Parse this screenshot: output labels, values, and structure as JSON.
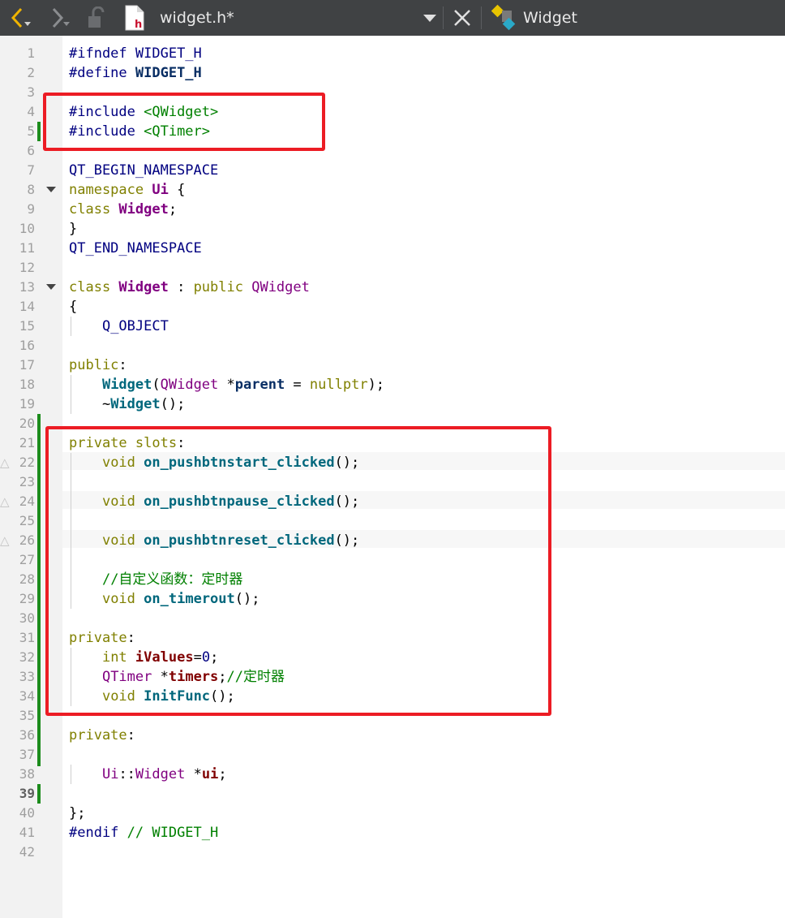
{
  "toolbar": {
    "file_name": "widget.h*",
    "class_name": "Widget",
    "icons": [
      "back-arrow-icon",
      "forward-arrow-icon",
      "lock-icon",
      "header-file-icon",
      "dropdown-arrow-icon",
      "close-icon",
      "class-icon"
    ],
    "colors": {
      "background": "#404244",
      "text": "#e8e8e8",
      "back_arrow": "#f0b400"
    }
  },
  "editor": {
    "line_numbers": [
      "1",
      "2",
      "3",
      "4",
      "5",
      "6",
      "7",
      "8",
      "9",
      "10",
      "11",
      "12",
      "13",
      "14",
      "15",
      "16",
      "17",
      "18",
      "19",
      "20",
      "21",
      "22",
      "23",
      "24",
      "25",
      "26",
      "27",
      "28",
      "29",
      "30",
      "31",
      "32",
      "33",
      "34",
      "35",
      "36",
      "37",
      "38",
      "39",
      "40",
      "41",
      "42"
    ],
    "current_line": "39",
    "folded_lines": [
      "8",
      "13"
    ],
    "warning_lines": [
      "22",
      "24",
      "26"
    ],
    "warning_glyph": "△",
    "lines": {
      "l1a": "#ifndef",
      "l1b": " WIDGET_H",
      "l2a": "#define",
      "l2b": " WIDGET_H",
      "l4a": "#include",
      "l4b": " <QWidget>",
      "l5a": "#include",
      "l5b": " <QTimer>",
      "l7a": "QT_BEGIN_NAMESPACE",
      "l8a": "namespace",
      "l8b": " Ui",
      "l8c": " {",
      "l9a": "class",
      "l9b": " Widget",
      "l9c": ";",
      "l10a": "}",
      "l11a": "QT_END_NAMESPACE",
      "l13a": "class",
      "l13b": " Widget",
      "l13c": " :",
      "l13d": " public",
      "l13e": " QWidget",
      "l14a": "{",
      "l15a": "    ",
      "l15b": "Q_OBJECT",
      "l17a": "public",
      "l17b": ":",
      "l18a": "    ",
      "l18b": "Widget",
      "l18c": "(",
      "l18d": "QWidget",
      "l18e": " *",
      "l18f": "parent",
      "l18g": " = ",
      "l18h": "nullptr",
      "l18i": ");",
      "l19a": "    ~",
      "l19b": "Widget",
      "l19c": "();",
      "l21a": "private",
      "l21b": " slots",
      "l21c": ":",
      "l22a": "    ",
      "l22b": "void",
      "l22c": " ",
      "l22d": "on_pushbtnstart_clicked",
      "l22e": "();",
      "l24a": "    ",
      "l24b": "void",
      "l24c": " ",
      "l24d": "on_pushbtnpause_clicked",
      "l24e": "();",
      "l26a": "    ",
      "l26b": "void",
      "l26c": " ",
      "l26d": "on_pushbtnreset_clicked",
      "l26e": "();",
      "l28a": "    ",
      "l28b": "//自定义函数：定时器",
      "l29a": "    ",
      "l29b": "void",
      "l29c": " ",
      "l29d": "on_timerout",
      "l29e": "();",
      "l31a": "private",
      "l31b": ":",
      "l32a": "    ",
      "l32b": "int",
      "l32c": " ",
      "l32d": "iValues",
      "l32e": "=",
      "l32f": "0",
      "l32g": ";",
      "l33a": "    ",
      "l33b": "QTimer",
      "l33c": " *",
      "l33d": "timers",
      "l33e": ";",
      "l33f": "//定时器",
      "l34a": "    ",
      "l34b": "void",
      "l34c": " ",
      "l34d": "InitFunc",
      "l34e": "();",
      "l36a": "private",
      "l36b": ":",
      "l38a": "    ",
      "l38b": "Ui",
      "l38c": "::",
      "l38d": "Widget",
      "l38e": " *",
      "l38f": "ui",
      "l38g": ";",
      "l40a": "};",
      "l41a": "#endif",
      "l41b": " // WIDGET_H"
    }
  },
  "annotations": {
    "highlight_color": "#ec1c24"
  }
}
